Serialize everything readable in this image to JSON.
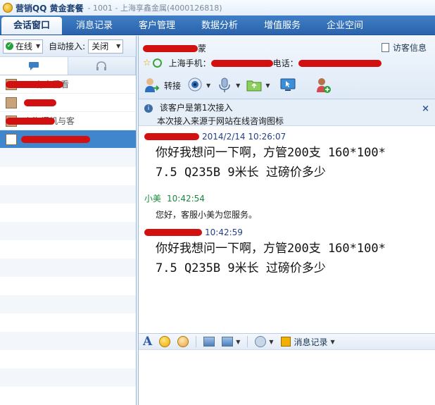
{
  "title": {
    "brand": "营销QQ 黄金套餐",
    "subtitle": "- 1001 - 上海享鑫金属(4000126818)"
  },
  "tabs": [
    "会话窗口",
    "消息记录",
    "客户管理",
    "数据分析",
    "增值服务",
    "企业空间"
  ],
  "status": {
    "online_label": "在线",
    "auto_accept_label": "自动接入:",
    "auto_accept_value": "关闭"
  },
  "visitor_info_label": "访客信息",
  "contact_header": {
    "name_suffix": "蒙",
    "phone_label": "上海手机：",
    "tel_label": "电话："
  },
  "transfer_label": "转接",
  "notice": {
    "line1": "该客户是第1次接入",
    "line2": "本次接入来源于网站在线咨询图标"
  },
  "messages": [
    {
      "time": "2014/2/14 10:26:07",
      "text_line1": "你好我想问一下啊，方管200支 160*100*",
      "text_line2": "7.5 Q235B 9米长 过磅价多少"
    },
    {
      "sender": "小美",
      "time": "10:42:54",
      "text": "您好，客服小美为您服务。"
    },
    {
      "time": "10:42:59",
      "text_line1": "你好我想问一下啊，方管200支 160*100*",
      "text_line2": "7.5 Q235B 9米长 过磅价多少"
    }
  ],
  "contacts_partial": [
    "有空看看",
    "上海闲机与客"
  ],
  "history_label": "消息记录",
  "colors": {
    "tab_bar": "#2a63ac",
    "selected_row": "#3f86cd",
    "redaction": "#d31010",
    "agent_green": "#198a3a",
    "visitor_blue": "#23408a"
  }
}
